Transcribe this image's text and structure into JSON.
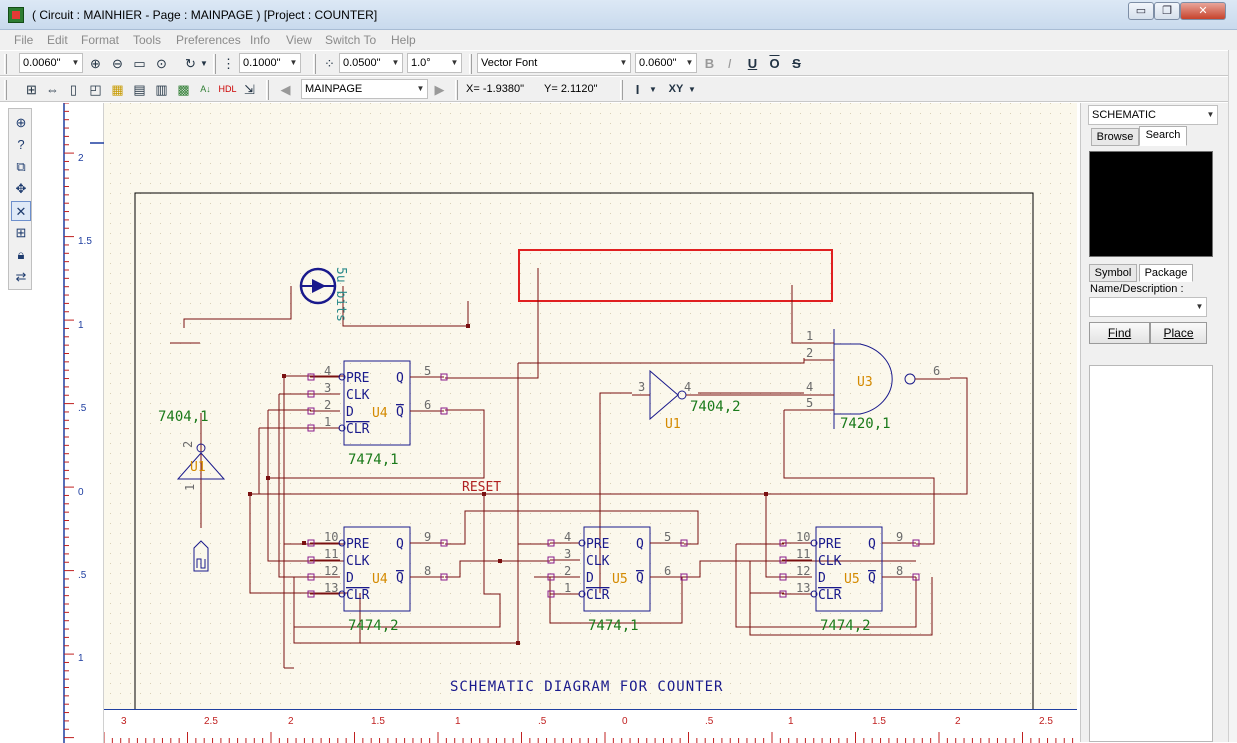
{
  "window": {
    "title": "( Circuit : MAINHIER - Page : MAINPAGE ) [Project : COUNTER]",
    "minimize_glyph": "▭",
    "restore_glyph": "❐",
    "close_glyph": "✕"
  },
  "menus": [
    "File",
    "Edit",
    "Format",
    "Tools",
    "Preferences",
    "Info",
    "View",
    "Switch To",
    "Help"
  ],
  "toolbar1": {
    "line_width": "0.0060\"",
    "grid_spacing": "0.1000\"",
    "snap_spacing": "0.0500\"",
    "angle": "1.0°",
    "font": "Vector Font",
    "font_size": "0.0600\"",
    "bold": "B",
    "italic": "I",
    "underline": "U",
    "overline": "O",
    "strike": "S"
  },
  "toolbar2": {
    "page": "MAINPAGE",
    "x_coord": "X= -1.9380\"",
    "y_coord": "Y= 2.1120\"",
    "i_label": "I",
    "xy_label": "XY"
  },
  "ruler": {
    "vertical": [
      "2",
      "1.5",
      "1",
      ".5",
      "0",
      ".5",
      "1"
    ],
    "horizontal": [
      "3",
      "2.5",
      "2",
      "1.5",
      "1",
      ".5",
      "0",
      ".5",
      "1",
      "1.5",
      "2",
      "2.5"
    ]
  },
  "schematic": {
    "caption": "SCHEMATIC DIAGRAM FOR COUNTER",
    "source_label": "5u bits",
    "reset_label": "RESET",
    "ff_pins": [
      "PRE",
      "CLK",
      "D",
      "CLR",
      "Q",
      "Q"
    ],
    "u4a": {
      "name": "U4",
      "part": "7474,1",
      "pins": [
        "4",
        "3",
        "2",
        "1",
        "5",
        "6"
      ]
    },
    "u4b": {
      "name": "U4",
      "part": "7474,2",
      "pins": [
        "10",
        "11",
        "12",
        "13",
        "9",
        "8"
      ]
    },
    "u5a": {
      "name": "U5",
      "part": "7474,1",
      "pins": [
        "4",
        "3",
        "2",
        "1",
        "5",
        "6"
      ]
    },
    "u5b": {
      "name": "U5",
      "part": "7474,2",
      "pins": [
        "10",
        "11",
        "12",
        "13",
        "9",
        "8"
      ]
    },
    "inv1": {
      "name": "U1",
      "part": "7404,1",
      "pins": [
        "2",
        "1"
      ]
    },
    "inv2": {
      "name": "U1",
      "part": "7404,2",
      "pins": [
        "3",
        "4"
      ]
    },
    "nand": {
      "name": "U3",
      "part": "7420,1",
      "pins": [
        "1",
        "2",
        "4",
        "5",
        "6"
      ]
    }
  },
  "panel": {
    "library": "SCHEMATIC",
    "tab_browse": "Browse",
    "tab_search": "Search",
    "tab_symbol": "Symbol",
    "tab_package": "Package",
    "name_label": "Name/Description :",
    "find": "Find",
    "place": "Place"
  },
  "colors": {
    "wire": "#7a1010",
    "symbol": "#1a1a8c",
    "pin_number": "#6b6b6b",
    "part_label": "#1a7a1a",
    "ref_label": "#d48a00",
    "highlight": "#e02020"
  }
}
